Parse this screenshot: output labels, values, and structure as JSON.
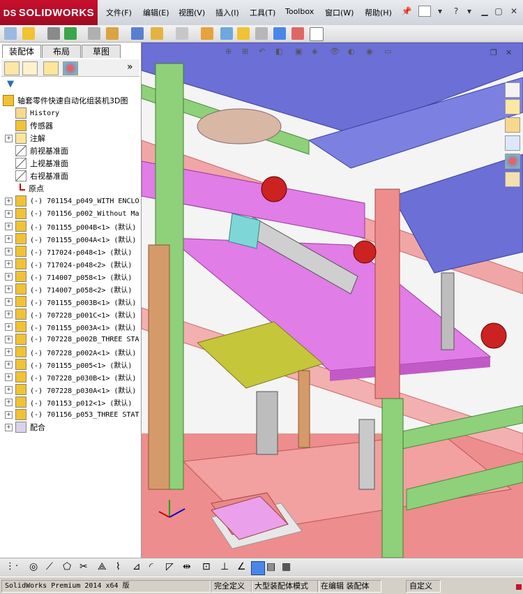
{
  "app": {
    "brand": "SOLIDWORKS",
    "brand_mark": "DS"
  },
  "menu": [
    "文件(F)",
    "编辑(E)",
    "视图(V)",
    "插入(I)",
    "工具(T)",
    "Toolbox",
    "窗口(W)",
    "帮助(H)"
  ],
  "panel_tabs": [
    "装配体",
    "布局",
    "草图"
  ],
  "tree": {
    "root": "轴套零件快速自动化组装机3D图",
    "items": [
      {
        "label": "History",
        "icon": "history-icon",
        "expand": false,
        "mono": true
      },
      {
        "label": "传感器",
        "icon": "sensor-icon",
        "expand": false
      },
      {
        "label": "注解",
        "icon": "annotation-icon",
        "expand": true
      },
      {
        "label": "前视基准面",
        "icon": "plane-icon",
        "expand": false
      },
      {
        "label": "上视基准面",
        "icon": "plane-icon",
        "expand": false
      },
      {
        "label": "右视基准面",
        "icon": "plane-icon",
        "expand": false
      },
      {
        "label": "原点",
        "icon": "origin-icon",
        "expand": false
      },
      {
        "label": "(-) 701154_p049_WITH ENCLO",
        "icon": "subassembly-icon",
        "expand": true,
        "mono": true
      },
      {
        "label": "(-) 701156_p002_Without Ma",
        "icon": "subassembly-icon",
        "expand": true,
        "mono": true
      },
      {
        "label": "(-) 701155_p004B<1> (默认)",
        "icon": "subassembly-icon",
        "expand": true,
        "mono": true
      },
      {
        "label": "(-) 701155_p004A<1> (默认)",
        "icon": "subassembly-icon",
        "expand": true,
        "mono": true
      },
      {
        "label": "(-) 717024-p048<1> (默认)",
        "icon": "subassembly-icon",
        "expand": true,
        "mono": true
      },
      {
        "label": "(-) 717024-p048<2> (默认)",
        "icon": "subassembly-icon",
        "expand": true,
        "mono": true
      },
      {
        "label": "(-) 714007_p058<1> (默认)",
        "icon": "subassembly-icon",
        "expand": true,
        "mono": true
      },
      {
        "label": "(-) 714007_p058<2> (默认)",
        "icon": "subassembly-icon",
        "expand": true,
        "mono": true
      },
      {
        "label": "(-) 701155_p003B<1> (默认)",
        "icon": "subassembly-icon",
        "expand": true,
        "mono": true
      },
      {
        "label": "(-) 707228_p001C<1> (默认)",
        "icon": "subassembly-icon",
        "expand": true,
        "mono": true
      },
      {
        "label": "(-) 701155_p003A<1> (默认)",
        "icon": "subassembly-icon",
        "expand": true,
        "mono": true
      },
      {
        "label": "(-) 707228_p002B_THREE STA",
        "icon": "subassembly-icon",
        "expand": true,
        "mono": true
      },
      {
        "label": "(-) 707228_p002A<1> (默认)",
        "icon": "subassembly-icon",
        "expand": true,
        "mono": true
      },
      {
        "label": "(-) 701155_p005<1> (默认)",
        "icon": "subassembly-icon",
        "expand": true,
        "mono": true
      },
      {
        "label": "(-) 707228_p030B<1> (默认)",
        "icon": "subassembly-icon",
        "expand": true,
        "mono": true
      },
      {
        "label": "(-) 707228_p030A<1> (默认)",
        "icon": "subassembly-icon",
        "expand": true,
        "mono": true
      },
      {
        "label": "(-) 701153_p012<1> (默认)",
        "icon": "subassembly-icon",
        "expand": true,
        "mono": true
      },
      {
        "label": "(-) 701156_p053_THREE STAT",
        "icon": "subassembly-icon",
        "expand": true,
        "mono": true
      },
      {
        "label": "配合",
        "icon": "mates-icon",
        "expand": true
      }
    ]
  },
  "status": {
    "version": "SolidWorks Premium 2014 x64 版",
    "state": "完全定义",
    "mode": "大型装配体模式",
    "editing": "在编辑 装配体",
    "custom": "自定义"
  },
  "colors": {
    "brand_red": "#c8102e",
    "frame_blue": "#6b6fd6",
    "column_green": "#8fd07a",
    "plate_magenta": "#e07de6",
    "base_salmon": "#ee8d8d",
    "wood_tan": "#d49a6a"
  }
}
